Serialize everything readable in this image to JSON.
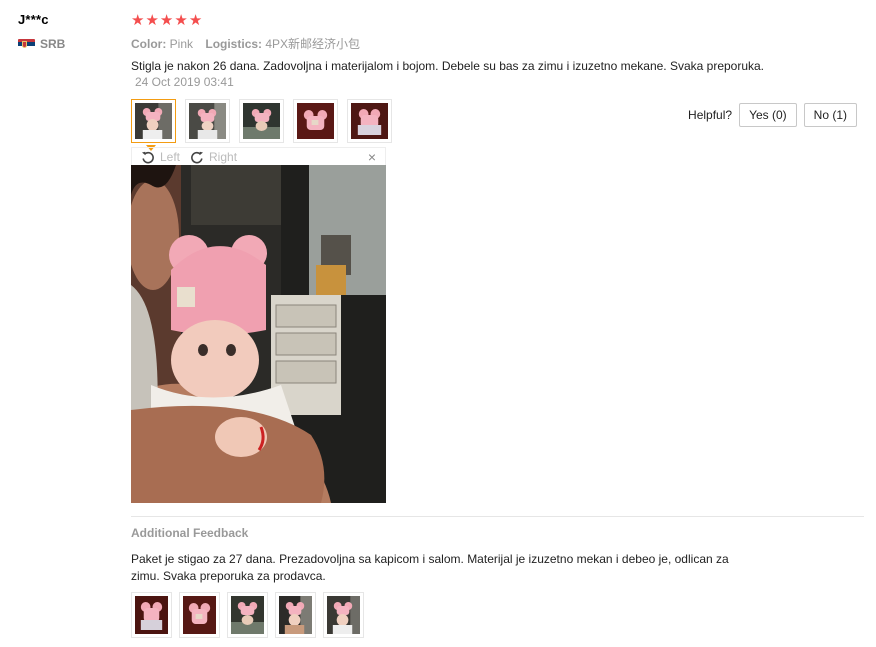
{
  "user": {
    "name": "J***c",
    "country_code": "SRB"
  },
  "review": {
    "stars": [
      "★",
      "★",
      "★",
      "★",
      "★"
    ],
    "rating_filled": 5,
    "color_label": "Color:",
    "color_value": "Pink",
    "logistics_label": "Logistics:",
    "logistics_value": "4PX新邮经济小包",
    "text": "Stigla je nakon 26 dana. Zadovoljna i materijalom i bojom. Debele su bas za zimu i izuzetno mekane. Svaka preporuka.",
    "date": "24 Oct 2019 03:41",
    "thumbnail_count": 5
  },
  "helpful": {
    "label": "Helpful?",
    "yes": "Yes (0)",
    "no": "No (1)"
  },
  "viewer": {
    "left_label": "Left",
    "right_label": "Right",
    "close_glyph": "×"
  },
  "additional": {
    "title": "Additional Feedback",
    "text": "Paket je stigao za 27 dana. Prezadovoljna sa kapicom i salom. Materijal je izuzetno mekan i debeo je, odlican za zimu. Svaka preporuka za prodavca.",
    "thumbnail_count": 5
  },
  "colors": {
    "star": "#f44e4e",
    "accent": "#f39c12",
    "muted": "#999999",
    "hat_pink": "#f2a9b6"
  },
  "icons": [
    "rotate-left-icon",
    "rotate-right-icon",
    "close-icon",
    "flag-serbia-icon",
    "star-icon"
  ]
}
